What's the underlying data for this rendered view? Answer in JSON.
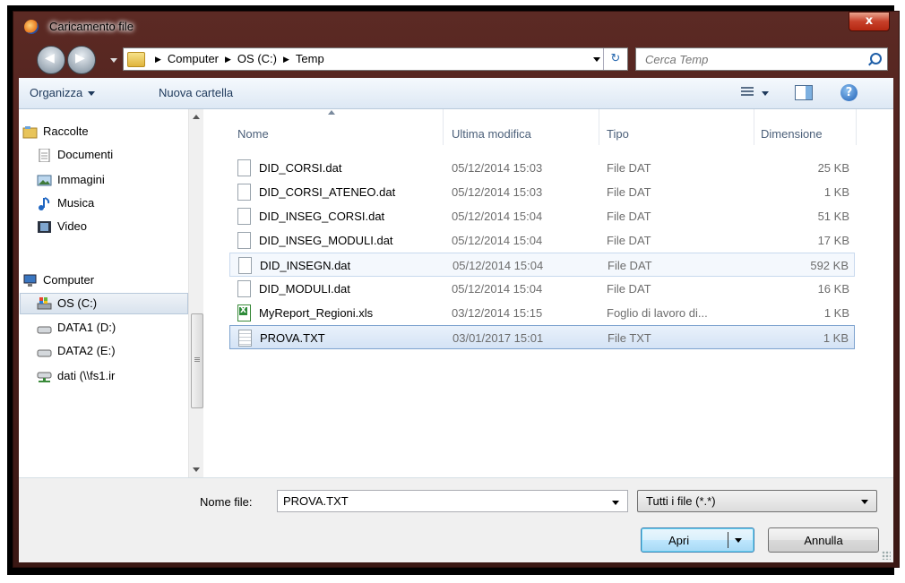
{
  "window": {
    "title": "Caricamento file",
    "close_label": "x"
  },
  "address": {
    "crumbs": [
      "Computer",
      "OS (C:)",
      "Temp"
    ],
    "search_placeholder": "Cerca Temp"
  },
  "toolbar": {
    "organize": "Organizza",
    "new_folder": "Nuova cartella",
    "help": "?"
  },
  "nav": {
    "items": [
      {
        "label": "Raccolte"
      },
      {
        "label": "Documenti"
      },
      {
        "label": "Immagini"
      },
      {
        "label": "Musica"
      },
      {
        "label": "Video"
      },
      {
        "label": "Computer"
      },
      {
        "label": "OS (C:)"
      },
      {
        "label": "DATA1 (D:)"
      },
      {
        "label": "DATA2 (E:)"
      },
      {
        "label": "dati (\\\\fs1.ir"
      }
    ]
  },
  "files": {
    "headers": {
      "name": "Nome",
      "modified": "Ultima modifica",
      "type": "Tipo",
      "size": "Dimensione"
    },
    "rows": [
      {
        "name": "DID_CORSI.dat",
        "modified": "05/12/2014 15:03",
        "type": "File DAT",
        "size": "25 KB"
      },
      {
        "name": "DID_CORSI_ATENEO.dat",
        "modified": "05/12/2014 15:03",
        "type": "File DAT",
        "size": "1 KB"
      },
      {
        "name": "DID_INSEG_CORSI.dat",
        "modified": "05/12/2014 15:04",
        "type": "File DAT",
        "size": "51 KB"
      },
      {
        "name": "DID_INSEG_MODULI.dat",
        "modified": "05/12/2014 15:04",
        "type": "File DAT",
        "size": "17 KB"
      },
      {
        "name": "DID_INSEGN.dat",
        "modified": "05/12/2014 15:04",
        "type": "File DAT",
        "size": "592 KB"
      },
      {
        "name": "DID_MODULI.dat",
        "modified": "05/12/2014 15:04",
        "type": "File DAT",
        "size": "16 KB"
      },
      {
        "name": "MyReport_Regioni.xls",
        "modified": "03/12/2014 15:15",
        "type": "Foglio di lavoro di...",
        "size": "1 KB"
      },
      {
        "name": "PROVA.TXT",
        "modified": "03/01/2017 15:01",
        "type": "File TXT",
        "size": "1 KB"
      }
    ]
  },
  "footer": {
    "filename_label": "Nome file:",
    "filename_value": "PROVA.TXT",
    "filter": "Tutti i file (*.*)",
    "open": "Apri",
    "cancel": "Annulla"
  }
}
